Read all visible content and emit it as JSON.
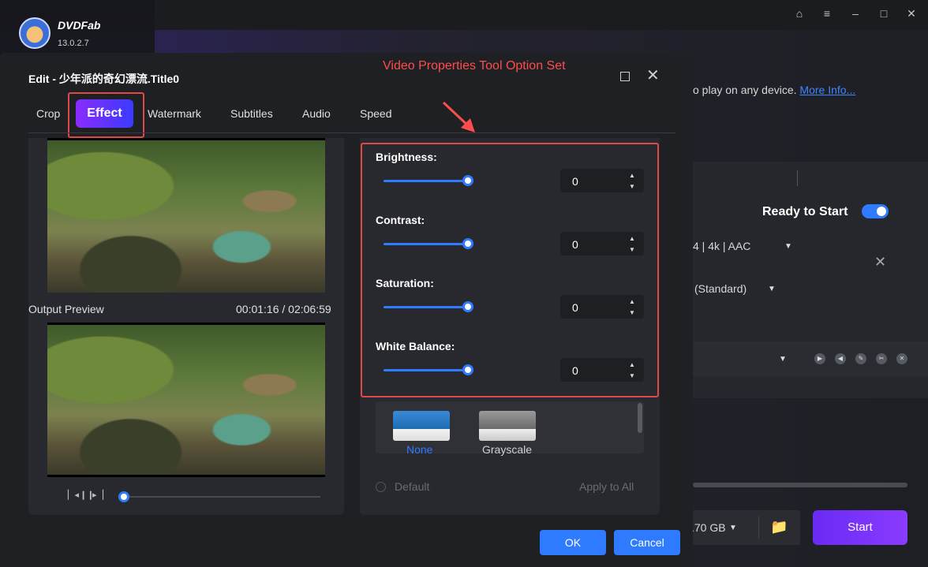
{
  "app": {
    "brand": "DVDFab",
    "version": "13.0.2.7",
    "window_controls": [
      "skin-icon",
      "menu-icon",
      "minimize-icon",
      "maximize-icon",
      "close-icon"
    ]
  },
  "background": {
    "info_text": "o play on any device.",
    "more_info_link": "More Info...",
    "ready_label": "Ready to Start",
    "format_text": "4 | 4k | AAC",
    "quality_text": "(Standard)",
    "size_text": ".70 GB",
    "start_label": "Start",
    "accent": "#2f7bff",
    "start_color": "#7a33ff"
  },
  "annotation": {
    "title": "Video Properties Tool Option Set",
    "color": "#ff4d4d"
  },
  "dialog": {
    "title": "Edit - 少年派的奇幻漂流.Title0",
    "tabs": [
      "Crop",
      "Effect",
      "Watermark",
      "Subtitles",
      "Audio",
      "Speed"
    ],
    "active_tab": "Effect",
    "output_preview_label": "Output Preview",
    "time_display": "00:01:16 / 02:06:59",
    "controls": [
      {
        "label": "Brightness:",
        "value": "0"
      },
      {
        "label": "Contrast:",
        "value": "0"
      },
      {
        "label": "Saturation:",
        "value": "0"
      },
      {
        "label": "White Balance:",
        "value": "0"
      }
    ],
    "filters": [
      {
        "label": "None",
        "selected": true
      },
      {
        "label": "Grayscale",
        "selected": false
      }
    ],
    "default_label": "Default",
    "apply_all_label": "Apply to All",
    "ok_label": "OK",
    "cancel_label": "Cancel"
  }
}
